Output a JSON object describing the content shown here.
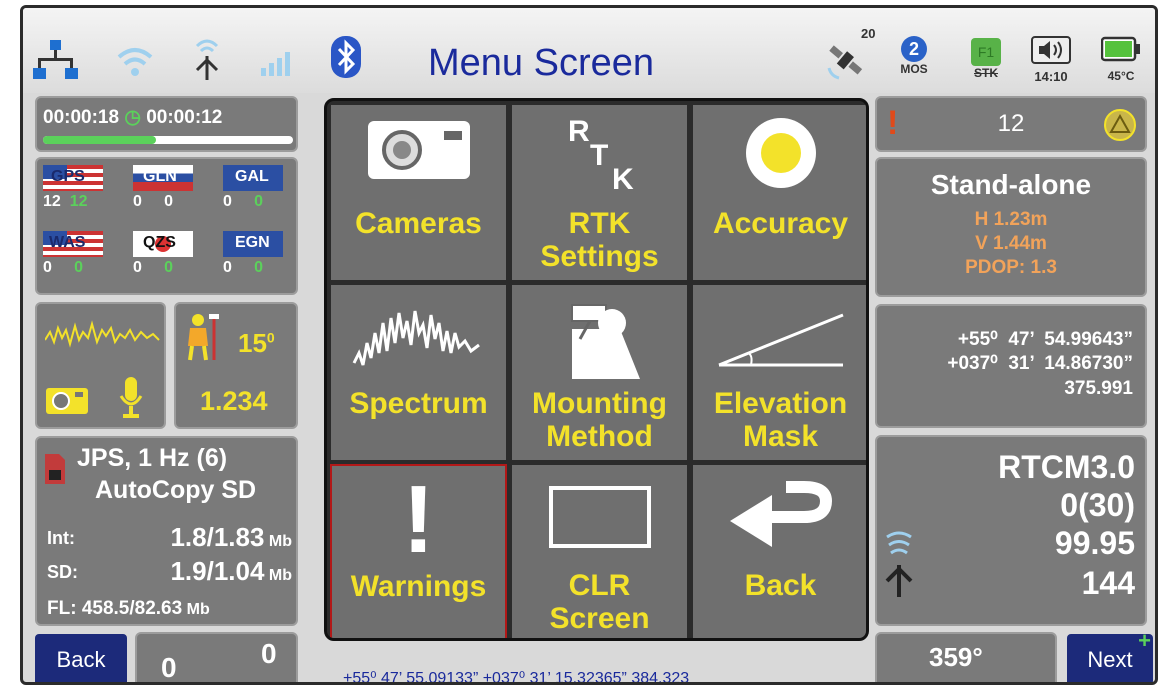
{
  "status_bar": {
    "title": "Menu Screen",
    "satellites": "20",
    "mos_count": "2",
    "mos_label": "MOS",
    "stk_label": "F1",
    "stk_sub": "STK",
    "time": "14:10",
    "temperature": "45°C"
  },
  "left": {
    "timer_elapsed": "00:00:18",
    "timer_remaining": "00:00:12",
    "constellations": [
      {
        "name": "GPS",
        "a": "12",
        "b": "12"
      },
      {
        "name": "GLN",
        "a": "0",
        "b": "0"
      },
      {
        "name": "GAL",
        "a": "0",
        "b": "0"
      },
      {
        "name": "WAS",
        "a": "0",
        "b": "0"
      },
      {
        "name": "QZS",
        "a": "0",
        "b": "0"
      },
      {
        "name": "EGN",
        "a": "0",
        "b": "0"
      }
    ],
    "elevation_mask": "15",
    "antenna_height": "1.234",
    "log_format": "JPS, 1 Hz (6)",
    "autocopy": "AutoCopy SD",
    "int_label": "Int:",
    "int_value": "1.8/1.83",
    "sd_label": "SD:",
    "sd_value": "1.9/1.04",
    "fl_value": "FL: 458.5/82.63",
    "unit": "Mb",
    "back_label": "Back",
    "counter_left": "0",
    "counter_right": "0"
  },
  "menu": {
    "tiles": [
      {
        "label": "Cameras"
      },
      {
        "label": "RTK\nSettings"
      },
      {
        "label": "Accuracy"
      },
      {
        "label": "Spectrum"
      },
      {
        "label": "Mounting\nMethod"
      },
      {
        "label": "Elevation\nMask"
      },
      {
        "label": "Warnings"
      },
      {
        "label": "CLR\nScreen"
      },
      {
        "label": "Back"
      }
    ],
    "rtk_letters": [
      "R",
      "T",
      "K"
    ]
  },
  "right": {
    "warning_count": "12",
    "solution": "Stand-alone",
    "h_acc": "H 1.23m",
    "v_acc": "V 1.44m",
    "pdop": "PDOP: 1.3",
    "lat": "+55⁰  47’  54.99643”",
    "lon": "+037⁰  31’  14.86730”",
    "height": "375.991",
    "rtcm": "RTCM3.0",
    "link1": "0(30)",
    "link2": "99.95",
    "link3": "144",
    "heading": "359°",
    "next_label": "Next"
  },
  "bottom": {
    "coords": "+55⁰ 47’ 55.09133”  +037⁰ 31’ 15.32365”  384.323"
  }
}
